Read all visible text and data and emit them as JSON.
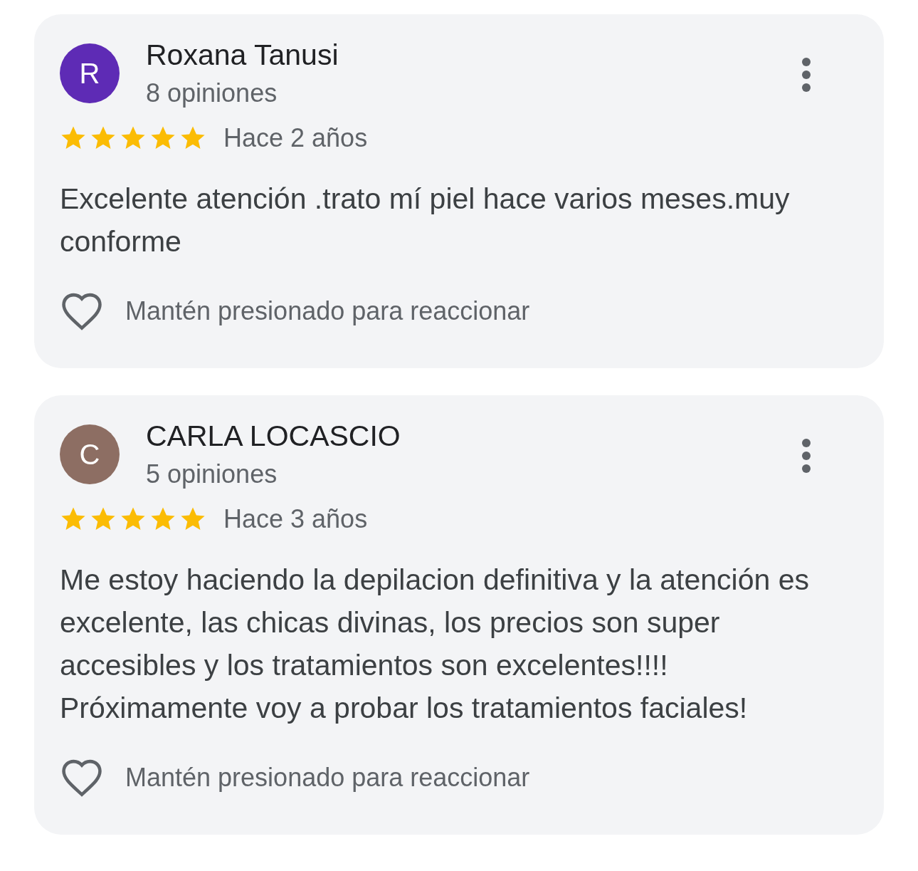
{
  "reviews": [
    {
      "initial": "R",
      "color": "#5e2bb5",
      "author": "Roxana Tanusi",
      "count": "8 opiniones",
      "stars": 5,
      "time": "Hace 2 años",
      "text": "Excelente atención .trato mí piel hace varios meses.muy conforme",
      "reaction": "Mantén presionado para reaccionar"
    },
    {
      "initial": "C",
      "color": "#8d6e63",
      "author": "CARLA LOCASCIO",
      "count": "5 opiniones",
      "stars": 5,
      "time": "Hace 3 años",
      "text": "Me estoy haciendo la depilacion definitiva y la atención es excelente, las chicas divinas, los precios son super accesibles y los tratamientos son excelentes!!!! Próximamente voy a probar los tratamientos faciales!",
      "reaction": "Mantén presionado para reaccionar"
    }
  ]
}
